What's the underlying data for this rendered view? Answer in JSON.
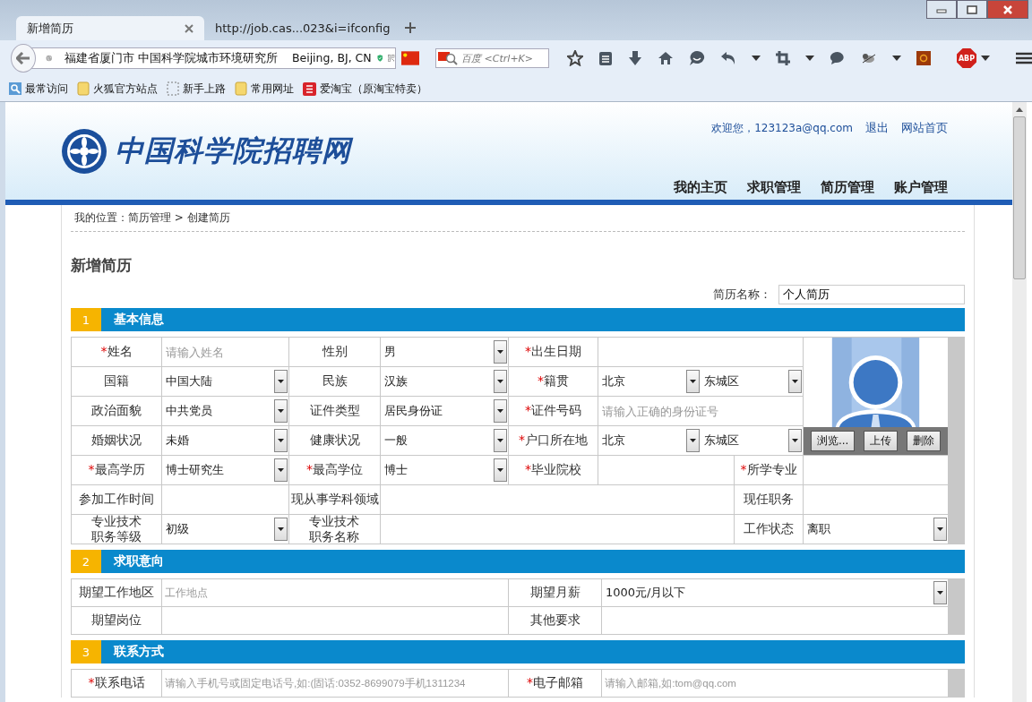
{
  "browser": {
    "tabs": [
      {
        "title": "新增简历",
        "selected": true
      },
      {
        "title": "http://job.cas...023&i=ifconfig",
        "selected": false
      }
    ],
    "address": "福建省厦门市 中国科学院城市环境研究所    Beijing, BJ, CN",
    "search": {
      "placeholder": "百度 <Ctrl+K>"
    },
    "adblock_label": "ABP",
    "bookmarks": [
      {
        "kind": "smart",
        "label": "最常访问"
      },
      {
        "kind": "folder",
        "label": "火狐官方站点"
      },
      {
        "kind": "page",
        "label": "新手上路"
      },
      {
        "kind": "folder",
        "label": "常用网址"
      },
      {
        "kind": "shop",
        "label": "爱淘宝（原淘宝特卖）"
      }
    ]
  },
  "site": {
    "logo_text": "中国科学院招聘网",
    "welcome": "欢迎您，123123a@qq.com",
    "links": [
      "退出",
      "网站首页"
    ],
    "nav": [
      "我的主页",
      "求职管理",
      "简历管理",
      "账户管理"
    ]
  },
  "breadcrumb": "我的位置：简历管理 > 创建简历",
  "page_title": "新增简历",
  "resume_name": {
    "label": "简历名称：",
    "value": "个人简历"
  },
  "sections": [
    {
      "number": "1",
      "title": "基本信息",
      "rows": [
        [
          {
            "kind": "label",
            "mark": "*",
            "text": "姓名"
          },
          {
            "kind": "input",
            "placeholder": "请输入姓名"
          },
          {
            "kind": "label",
            "text": "性别"
          },
          {
            "kind": "select",
            "value": "男"
          },
          {
            "kind": "label",
            "mark": "*",
            "text": "出生日期"
          },
          {
            "kind": "input"
          }
        ],
        [
          {
            "kind": "label",
            "text": "国籍"
          },
          {
            "kind": "select",
            "value": "中国大陆"
          },
          {
            "kind": "label",
            "text": "民族"
          },
          {
            "kind": "select",
            "value": "汉族"
          },
          {
            "kind": "label",
            "mark": "*",
            "text": "籍贯"
          },
          {
            "kind": "select_pair",
            "values": [
              "北京",
              "东城区"
            ]
          }
        ],
        [
          {
            "kind": "label",
            "text": "政治面貌"
          },
          {
            "kind": "select",
            "value": "中共党员"
          },
          {
            "kind": "label",
            "text": "证件类型"
          },
          {
            "kind": "select",
            "value": "居民身份证"
          },
          {
            "kind": "label",
            "mark": "*",
            "text": "证件号码"
          },
          {
            "kind": "input",
            "placeholder": "请输入正确的身份证号"
          }
        ],
        [
          {
            "kind": "label",
            "text": "婚姻状况"
          },
          {
            "kind": "select",
            "value": "未婚"
          },
          {
            "kind": "label",
            "text": "健康状况"
          },
          {
            "kind": "select",
            "value": "一般"
          },
          {
            "kind": "label",
            "mark": "*",
            "text": "户口所在地"
          },
          {
            "kind": "select_pair",
            "values": [
              "北京",
              "东城区"
            ]
          }
        ],
        [
          {
            "kind": "label",
            "mark": "*",
            "text": "最高学历"
          },
          {
            "kind": "select",
            "value": "博士研究生"
          },
          {
            "kind": "label",
            "mark": "*",
            "text": "最高学位"
          },
          {
            "kind": "select",
            "value": "博士"
          },
          {
            "kind": "label",
            "mark": "*",
            "text": "毕业院校"
          },
          {
            "kind": "input"
          },
          {
            "kind": "label",
            "mark": "*",
            "text": "所学专业"
          },
          {
            "kind": "input"
          }
        ],
        [
          {
            "kind": "label",
            "text": "参加工作时间"
          },
          {
            "kind": "input"
          },
          {
            "kind": "label",
            "text": "现从事学科领域"
          },
          {
            "kind": "input"
          },
          {
            "kind": "label",
            "text": "现任职务"
          },
          {
            "kind": "input"
          }
        ],
        [
          {
            "kind": "label",
            "text": "专业技术职务等级"
          },
          {
            "kind": "select",
            "value": "初级"
          },
          {
            "kind": "label",
            "text": "专业技术职务名称"
          },
          {
            "kind": "input"
          },
          {
            "kind": "label",
            "text": "工作状态"
          },
          {
            "kind": "select",
            "value": "离职"
          }
        ]
      ],
      "photo_buttons": [
        "浏览...",
        "上传",
        "删除"
      ]
    },
    {
      "number": "2",
      "title": "求职意向",
      "rows": [
        [
          {
            "kind": "label",
            "text": "期望工作地区"
          },
          {
            "kind": "input",
            "placeholder": "工作地点"
          },
          {
            "kind": "label",
            "text": "期望月薪"
          },
          {
            "kind": "select",
            "value": "1000元/月以下"
          }
        ],
        [
          {
            "kind": "label",
            "text": "期望岗位"
          },
          {
            "kind": "input"
          },
          {
            "kind": "label",
            "text": "其他要求"
          },
          {
            "kind": "input"
          }
        ]
      ]
    },
    {
      "number": "3",
      "title": "联系方式",
      "rows": [
        [
          {
            "kind": "label",
            "mark": "*",
            "text": "联系电话"
          },
          {
            "kind": "input",
            "placeholder": "请输入手机号或固定电话号,如:(固话:0352-8699079手机1311234"
          },
          {
            "kind": "label",
            "mark": "*",
            "text": "电子邮箱"
          },
          {
            "kind": "input",
            "placeholder": "请输入邮箱,如:tom@qq.com"
          }
        ]
      ]
    }
  ]
}
